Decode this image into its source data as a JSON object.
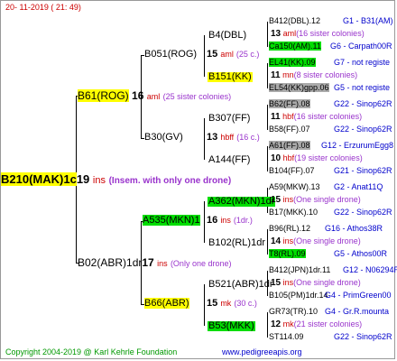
{
  "header": {
    "date": "20- 11-2019 ( 21: 49)"
  },
  "footer": {
    "copyright": "Copyright 2004-2019 @ Karl Kehrle Foundation",
    "site": "www.pedigreeapis.org"
  },
  "root": {
    "name": "B210(MAK)1c",
    "num": "19",
    "unit": "ins",
    "note": "(Insem. with only one drone)"
  },
  "g1": [
    {
      "name": "B61(ROG)",
      "num": "16",
      "unit": "aml",
      "note": "(25 sister colonies)"
    },
    {
      "name": "B02(ABR)1dr",
      "num": "17",
      "unit": "ins",
      "note": "(Only one drone)"
    }
  ],
  "g2": [
    {
      "name": "B051(ROG)",
      "num": "15",
      "unit": "aml",
      "note": "(25 c.)"
    },
    {
      "name": "B30(GV)",
      "num": "13",
      "unit": "hbff",
      "note": "(16 c.)"
    },
    {
      "name": "A535(MKN)1",
      "num": "16",
      "unit": "ins",
      "note": "(1dr.)"
    },
    {
      "name": "B66(ABR)",
      "num": "15",
      "unit": "mk",
      "note": "(30 c.)"
    }
  ],
  "g3": [
    {
      "name": "B4(DBL)"
    },
    {
      "name": "B151(KK)",
      "num": "11",
      "unit": "mn",
      "note": "(8 sister colonies)"
    },
    {
      "name": "B307(FF)",
      "num": "11",
      "unit": "hbf",
      "note": "(16 sister colonies)"
    },
    {
      "name": "A144(FF)",
      "num": "10",
      "unit": "hbf",
      "note": "(19 sister colonies)"
    },
    {
      "name": "A362(MKN)1dr",
      "num": "15",
      "unit": "ins",
      "note": "(One single drone)"
    },
    {
      "name": "B102(RL)1dr",
      "num": "14",
      "unit": "ins",
      "note": "(One single drone)"
    },
    {
      "name": "B521(ABR)1dr",
      "num": "15",
      "unit": "ins",
      "note": "(One single drone)"
    },
    {
      "name": "B53(MKK)",
      "num": "12",
      "unit": "mk",
      "note": "(21 sister colonies)"
    }
  ],
  "g4": [
    {
      "name": "B412(DBL).12",
      "info": "G1 - B31(AM)"
    },
    {
      "name": "Ca150(AM).11",
      "info": "G6 - Carpath00R"
    },
    {
      "name": "EL41(KK).09",
      "info": "G7 - not registe"
    },
    {
      "name": "EL54(KK)gpp.06",
      "info": "G5 - not registe"
    },
    {
      "name": "B62(FF).08",
      "info": "G22 - Sinop62R"
    },
    {
      "name": "B58(FF).07",
      "info": "G22 - Sinop62R"
    },
    {
      "name": "A61(FF).08",
      "info": "G12 - ErzurumEgg8"
    },
    {
      "name": "B104(FF).07",
      "info": "G21 - Sinop62R"
    },
    {
      "name": "A59(MKW).13",
      "info": "G2 - Anat11Q"
    },
    {
      "name": "B17(MKK).10",
      "info": "G22 - Sinop62R"
    },
    {
      "name": "B96(RL).12",
      "info": "G16 - Athos38R"
    },
    {
      "name": "T8(RL).09",
      "info": "G5 - Athos00R"
    },
    {
      "name": "B412(JPN)1dr.11",
      "info": "G12 - N06294R"
    },
    {
      "name": "B105(PM)1dr.14",
      "info": "G4 - PrimGreen00"
    },
    {
      "name": "GR73(TR).10",
      "info": "G4 - Gr.R.mounta"
    },
    {
      "name": "ST114.09",
      "info": "G22 - Sinop62R"
    }
  ],
  "g4_mid": [
    {
      "num": "13",
      "unit": "aml",
      "note": "(16 sister colonies)"
    },
    {
      "num": "11",
      "unit": "mn",
      "note": "(8 sister colonies)"
    },
    {
      "num": "11",
      "unit": "hbf",
      "note": "(16 sister colonies)"
    },
    {
      "num": "10",
      "unit": "hbf",
      "note": "(19 sister colonies)"
    },
    {
      "num": "15",
      "unit": "ins",
      "note": "(One single drone)"
    },
    {
      "num": "14",
      "unit": "ins",
      "note": "(One single drone)"
    },
    {
      "num": "15",
      "unit": "ins",
      "note": "(One single drone)"
    },
    {
      "num": "12",
      "unit": "mk",
      "note": "(21 sister colonies)"
    }
  ]
}
